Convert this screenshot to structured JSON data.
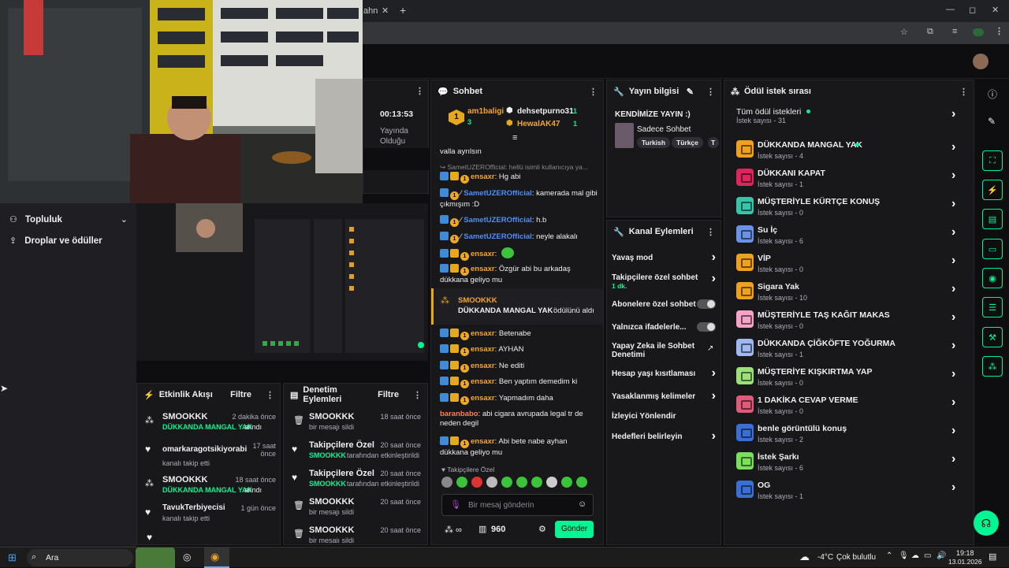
{
  "chrome": {
    "tab_fragment": "ahn",
    "controls": {
      "minimize": "—",
      "maximize": "◻",
      "close": "✕"
    }
  },
  "sidebar": {
    "items": [
      {
        "label": "Topluluk"
      },
      {
        "label": "Droplar ve ödüller"
      }
    ]
  },
  "stream_stats": {
    "time": "00:13:53",
    "line1": "Yayında",
    "line2": "Olduğu"
  },
  "activity": {
    "title": "Etkinlik Akışı",
    "filter": "Filtre",
    "items": [
      {
        "user": "SMOOKKK",
        "time": "2 dakika önce",
        "action": "DÜKKANDA MANGAL YAK",
        "suffix": "alındı"
      },
      {
        "user": "omarkaragotsikiyorabi",
        "time1": "17 saat",
        "time2": "önce",
        "desc": "kanalı takip etti"
      },
      {
        "user": "SMOOKKK",
        "time": "18 saat önce",
        "action": "DÜKKANDA MANGAL YAK",
        "suffix": "alındı"
      },
      {
        "user": "TavukTerbiyecisi",
        "time": "1 gün önce",
        "desc": "kanalı takip etti"
      }
    ]
  },
  "moderation": {
    "title": "Denetim Eylemleri",
    "filter": "Filtre",
    "items": [
      {
        "title": "SMOOKKK",
        "time": "18 saat önce",
        "desc": "bir mesajı sildi"
      },
      {
        "title": "Takipçilere Özel",
        "time": "20 saat önce",
        "user": "SMOOKKK",
        "desc": "tarafından etkinleştirildi"
      },
      {
        "title": "Takipçilere Özel",
        "time": "20 saat önce",
        "user": "SMOOKKK",
        "desc": "tarafından etkinleştirildi"
      },
      {
        "title": "SMOOKKK",
        "time": "20 saat önce",
        "desc": "bir mesajı sildi"
      },
      {
        "title": "SMOOKKK",
        "time": "20 saat önce",
        "desc": "bir mesajı sildi"
      }
    ]
  },
  "chat": {
    "title": "Sohbet",
    "leaderboard": {
      "rank": "1",
      "first_user": "am1baligi",
      "first_count": "3",
      "second_user": "dehsetpurno31",
      "second_count": "1",
      "third_user": "HewalAK47",
      "third_count": "1"
    },
    "top_partial": "valla ayrılsın",
    "reply_hint": "SametUZEROfficial: hellü isimli kullanıcıya yа...",
    "messages": [
      {
        "user": "ensaxr",
        "text": "Hg abi"
      },
      {
        "user": "SametUZEROfficial",
        "text": "kamerada mal gibi çıkmışım :D"
      },
      {
        "user": "SametUZEROfficial",
        "text": "h.b"
      },
      {
        "user": "SametUZEROfficial",
        "text": "neyle alakalı"
      },
      {
        "user": "ensaxr",
        "text": ""
      },
      {
        "user": "ensaxr",
        "text": "Özgür abi bu arkadaş dükkana geliyo mu"
      }
    ],
    "redeem": {
      "user": "SMOOKKK",
      "reward": "DÜKKANDA MANGAL YAK",
      "suffix": "ödülünü aldı"
    },
    "messages2": [
      {
        "user": "ensaxr",
        "text": "Betenabe"
      },
      {
        "user": "ensaxr",
        "text": "AYHAN"
      },
      {
        "user": "ensaxr",
        "text": "Ne editi"
      },
      {
        "user": "ensaxr",
        "text": "Ben yaptım demedim ki"
      },
      {
        "user": "ensaxr",
        "text": "Yapmadım daha"
      },
      {
        "user": "baranbabo",
        "text": "abi cigara avrupada legal tr de neden degil"
      },
      {
        "user": "ensaxr",
        "text": "Abi bete nabe ayhan dükkana geliyo mu"
      }
    ],
    "followers_only": "Takipçilere Özel",
    "placeholder": "Bir mesaj gönderin",
    "points": "960",
    "send": "Gönder"
  },
  "stream_info": {
    "title": "Yayın bilgisi",
    "stream_title": "KENDİMİZE YAYIN :)",
    "category": "Sadece Sohbet",
    "tags": [
      "Turkish",
      "Türkçe",
      "T"
    ]
  },
  "channel_actions": {
    "title": "Kanal Eylemleri",
    "items": [
      {
        "label": "Yavaş mod",
        "control": "chevron"
      },
      {
        "label": "Takipçilere özel sohbet",
        "extra": "1 dk.",
        "control": "chevron"
      },
      {
        "label": "Abonelere özel sohbet",
        "control": "toggle"
      },
      {
        "label": "Yalnızca ifadelerle...",
        "control": "toggle"
      },
      {
        "label": "Yapay Zeka ile Sohbet Denetimi",
        "control": "external"
      },
      {
        "label": "Hesap yaşı kısıtlaması",
        "control": "chevron"
      },
      {
        "label": "Yasaklanmış kelimeler",
        "control": "chevron"
      },
      {
        "label": "İzleyici Yönlendir",
        "control": "none"
      },
      {
        "label": "Hedefleri belirleyin",
        "control": "chevron"
      }
    ]
  },
  "rewards": {
    "title": "Ödül istek sırası",
    "all_title": "Tüm ödül istekleri",
    "all_count": "İstek sayısı - 31",
    "items": [
      {
        "name": "DÜKKANDA MANGAL YAK",
        "count": "İstek sayısı - 4",
        "color": "#f0a020",
        "dot": true
      },
      {
        "name": "DÜKKANI KAPAT",
        "count": "İstek sayısı - 1",
        "color": "#e0245e"
      },
      {
        "name": "MÜŞTERİYLE KÜRTÇE KONUŞ",
        "count": "İstek sayısı - 0",
        "color": "#36c5a8"
      },
      {
        "name": "Su İç",
        "count": "İstek sayısı - 6",
        "color": "#6a93e8"
      },
      {
        "name": "VİP",
        "count": "İstek sayısı - 0",
        "color": "#f0a020"
      },
      {
        "name": "Sigara Yak",
        "count": "İstek sayısı - 10",
        "color": "#f0a020"
      },
      {
        "name": "MÜŞTERİYLE TAŞ KAĞIT MAKAS",
        "count": "İstek sayısı - 0",
        "color": "#f5a3c7"
      },
      {
        "name": "DÜKKANDA ÇİĞKÖFTE YOĞURMA",
        "count": "İstek sayısı - 1",
        "color": "#a0b8f0"
      },
      {
        "name": "MÜŞTERİYE KIŞKIRTMA YAP",
        "count": "İstek sayısı - 0",
        "color": "#9ce07a"
      },
      {
        "name": "1 DAKİKA CEVAP VERME",
        "count": "İstek sayısı - 0",
        "color": "#e05a7a"
      },
      {
        "name": "benle görüntülü konuş",
        "count": "İstek sayısı - 2",
        "color": "#3b6fd6"
      },
      {
        "name": "İstek Şarkı",
        "count": "İstek sayısı - 6",
        "color": "#7ae05a"
      },
      {
        "name": "OG",
        "count": "İstek sayısı - 1",
        "color": "#3b6fd6"
      }
    ]
  },
  "taskbar": {
    "search": "Ara",
    "weather_temp": "-4°C",
    "weather_desc": "Çok bulutlu",
    "time": "19:18",
    "date": "13.01.2026"
  },
  "colors": {
    "accent": "#00f593",
    "bg": "#0e0e10",
    "panel": "#18181b"
  }
}
